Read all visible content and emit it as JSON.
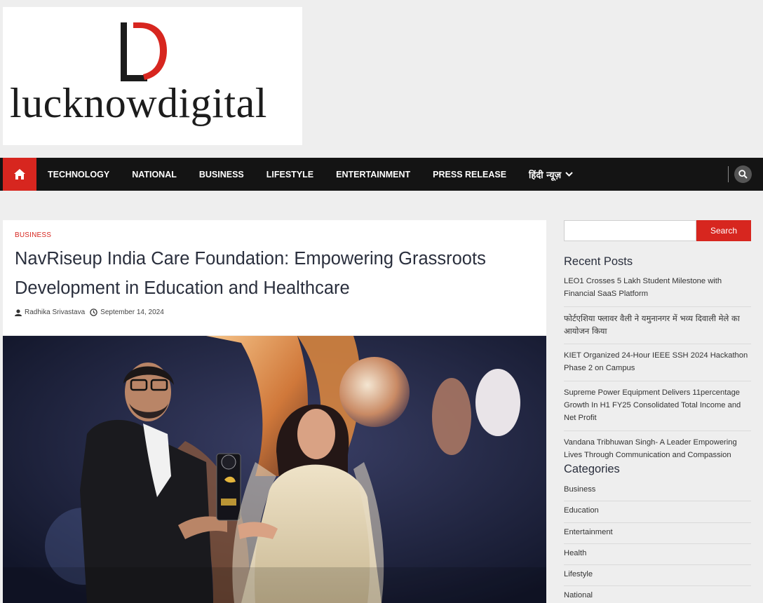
{
  "logo": {
    "text": "lucknowdigital"
  },
  "nav": {
    "items": [
      {
        "label": "TECHNOLOGY"
      },
      {
        "label": "NATIONAL"
      },
      {
        "label": "BUSINESS"
      },
      {
        "label": "LIFESTYLE"
      },
      {
        "label": "ENTERTAINMENT"
      },
      {
        "label": "PRESS RELEASE"
      },
      {
        "label": "हिंदी न्यूज़"
      }
    ]
  },
  "article": {
    "category": "BUSINESS",
    "title": "NavRiseup India Care Foundation: Empowering Grassroots Development in Education and Healthcare",
    "author": "Radhika Srivastava",
    "date": "September 14, 2024"
  },
  "sidebar": {
    "search_button": "Search",
    "recent_heading": "Recent Posts",
    "recent_posts": [
      "LEO1 Crosses 5 Lakh Student Milestone with Financial SaaS Platform",
      "फोर्टएशिया फ्लावर वैली ने यमुनानगर में भव्य दिवाली मेले का आयोजन किया",
      "KIET Organized 24-Hour IEEE SSH 2024 Hackathon Phase 2 on Campus",
      "Supreme Power Equipment Delivers 11percentage Growth In H1 FY25 Consolidated Total Income and Net Profit",
      "Vandana Tribhuwan Singh- A Leader Empowering Lives Through Communication and Compassion"
    ],
    "categories_heading": "Categories",
    "categories": [
      "Business",
      "Education",
      "Entertainment",
      "Health",
      "Lifestyle",
      "National"
    ]
  },
  "colors": {
    "accent": "#d7261f",
    "navbar": "#141414",
    "background": "#eeeeee"
  }
}
